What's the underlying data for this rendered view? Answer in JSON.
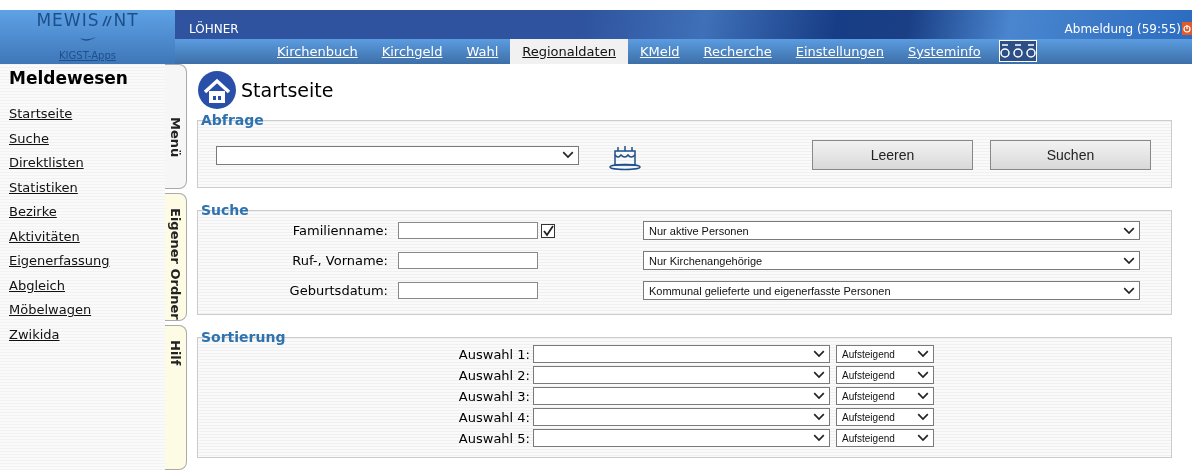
{
  "header": {
    "logo": {
      "left": "MEWIS",
      "right": "NT"
    },
    "apps_link": "KIGST-Apps",
    "user": "LÖHNER",
    "logout": "Abmeldung (59:55)"
  },
  "nav": [
    {
      "label": "Kirchenbuch",
      "selected": false
    },
    {
      "label": "Kirchgeld",
      "selected": false
    },
    {
      "label": "Wahl",
      "selected": false
    },
    {
      "label": "Regionaldaten",
      "selected": true
    },
    {
      "label": "KMeld",
      "selected": false
    },
    {
      "label": "Recherche",
      "selected": false
    },
    {
      "label": "Einstellungen",
      "selected": false
    },
    {
      "label": "Systeminfo",
      "selected": false
    }
  ],
  "sidebar": {
    "title": "Meldewesen",
    "items": [
      "Startseite",
      "Suche",
      "Direktlisten",
      "Statistiken",
      "Bezirke",
      "Aktivitäten",
      "Eigenerfassung",
      "Abgleich",
      "Möbelwagen",
      "Zwikida"
    ],
    "tabs": [
      {
        "label": "Menü",
        "selected": true
      },
      {
        "label": "Eigener Ordner",
        "selected": false
      },
      {
        "label": "Hilf",
        "selected": false
      }
    ]
  },
  "page_title": "Startseite",
  "abfrage": {
    "legend": "Abfrage",
    "buttons": [
      "Leeren",
      "Suchen"
    ]
  },
  "suche": {
    "legend": "Suche",
    "fields": [
      {
        "label": "Familienname:",
        "checkbox": {
          "checked": true
        },
        "filter": "Nur aktive Personen"
      },
      {
        "label": "Ruf-, Vorname:",
        "filter": "Nur Kirchenangehörige"
      },
      {
        "label": "Geburtsdatum:",
        "filter": "Kommunal gelieferte und eigenerfasste Personen"
      }
    ]
  },
  "sortierung": {
    "legend": "Sortierung",
    "rows": [
      {
        "label": "Auswahl 1:",
        "order": "Aufsteigend"
      },
      {
        "label": "Auswahl 2:",
        "order": "Aufsteigend"
      },
      {
        "label": "Auswahl 3:",
        "order": "Aufsteigend"
      },
      {
        "label": "Auswahl 4:",
        "order": "Aufsteigend"
      },
      {
        "label": "Auswahl 5:",
        "order": "Aufsteigend"
      }
    ]
  }
}
